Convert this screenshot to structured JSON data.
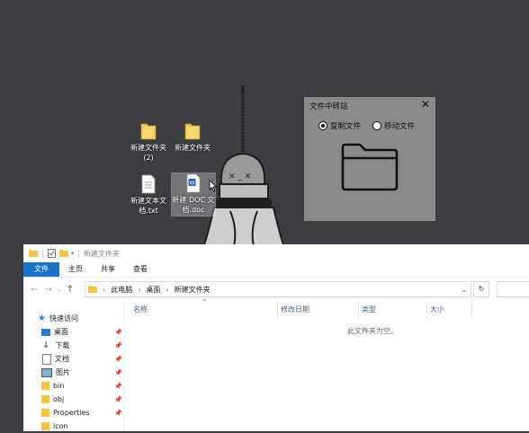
{
  "desktop": {
    "icons": [
      {
        "label": "新建文件夹\n(2)",
        "type": "folder"
      },
      {
        "label": "新建文件夹",
        "type": "folder"
      },
      {
        "label": "新建文本文档.txt",
        "type": "text"
      },
      {
        "label": "新建 DOC 文档.doc",
        "type": "word"
      }
    ]
  },
  "panel": {
    "title": "文件中转站",
    "option_copy": "复制文件",
    "option_move": "移动文件",
    "selected": "copy"
  },
  "explorer": {
    "title": "新建文件夹",
    "tabs": [
      "文件",
      "主页",
      "共享",
      "查看"
    ],
    "breadcrumb": [
      "此电脑",
      "桌面",
      "新建文件夹"
    ],
    "columns": [
      "名称",
      "修改日期",
      "类型",
      "大小"
    ],
    "empty_text": "此文件夹为空。",
    "nav": [
      {
        "label": "快速访问",
        "icon": "star-icon",
        "pinned": false
      },
      {
        "label": "桌面",
        "icon": "desktop-icon",
        "pinned": true
      },
      {
        "label": "下载",
        "icon": "download-icon",
        "pinned": true
      },
      {
        "label": "文档",
        "icon": "document-icon",
        "pinned": true
      },
      {
        "label": "图片",
        "icon": "picture-icon",
        "pinned": true
      },
      {
        "label": "bin",
        "icon": "folder-icon",
        "pinned": true
      },
      {
        "label": "obj",
        "icon": "folder-icon",
        "pinned": true
      },
      {
        "label": "Properties",
        "icon": "folder-icon",
        "pinned": true
      },
      {
        "label": "icon",
        "icon": "folder-icon",
        "pinned": false
      }
    ]
  },
  "colors": {
    "desktop_bg": "#3c3e42",
    "panel_bg": "#8a8a8a",
    "ribbon_file": "#1a73c6",
    "folder": "#f2c44c"
  }
}
